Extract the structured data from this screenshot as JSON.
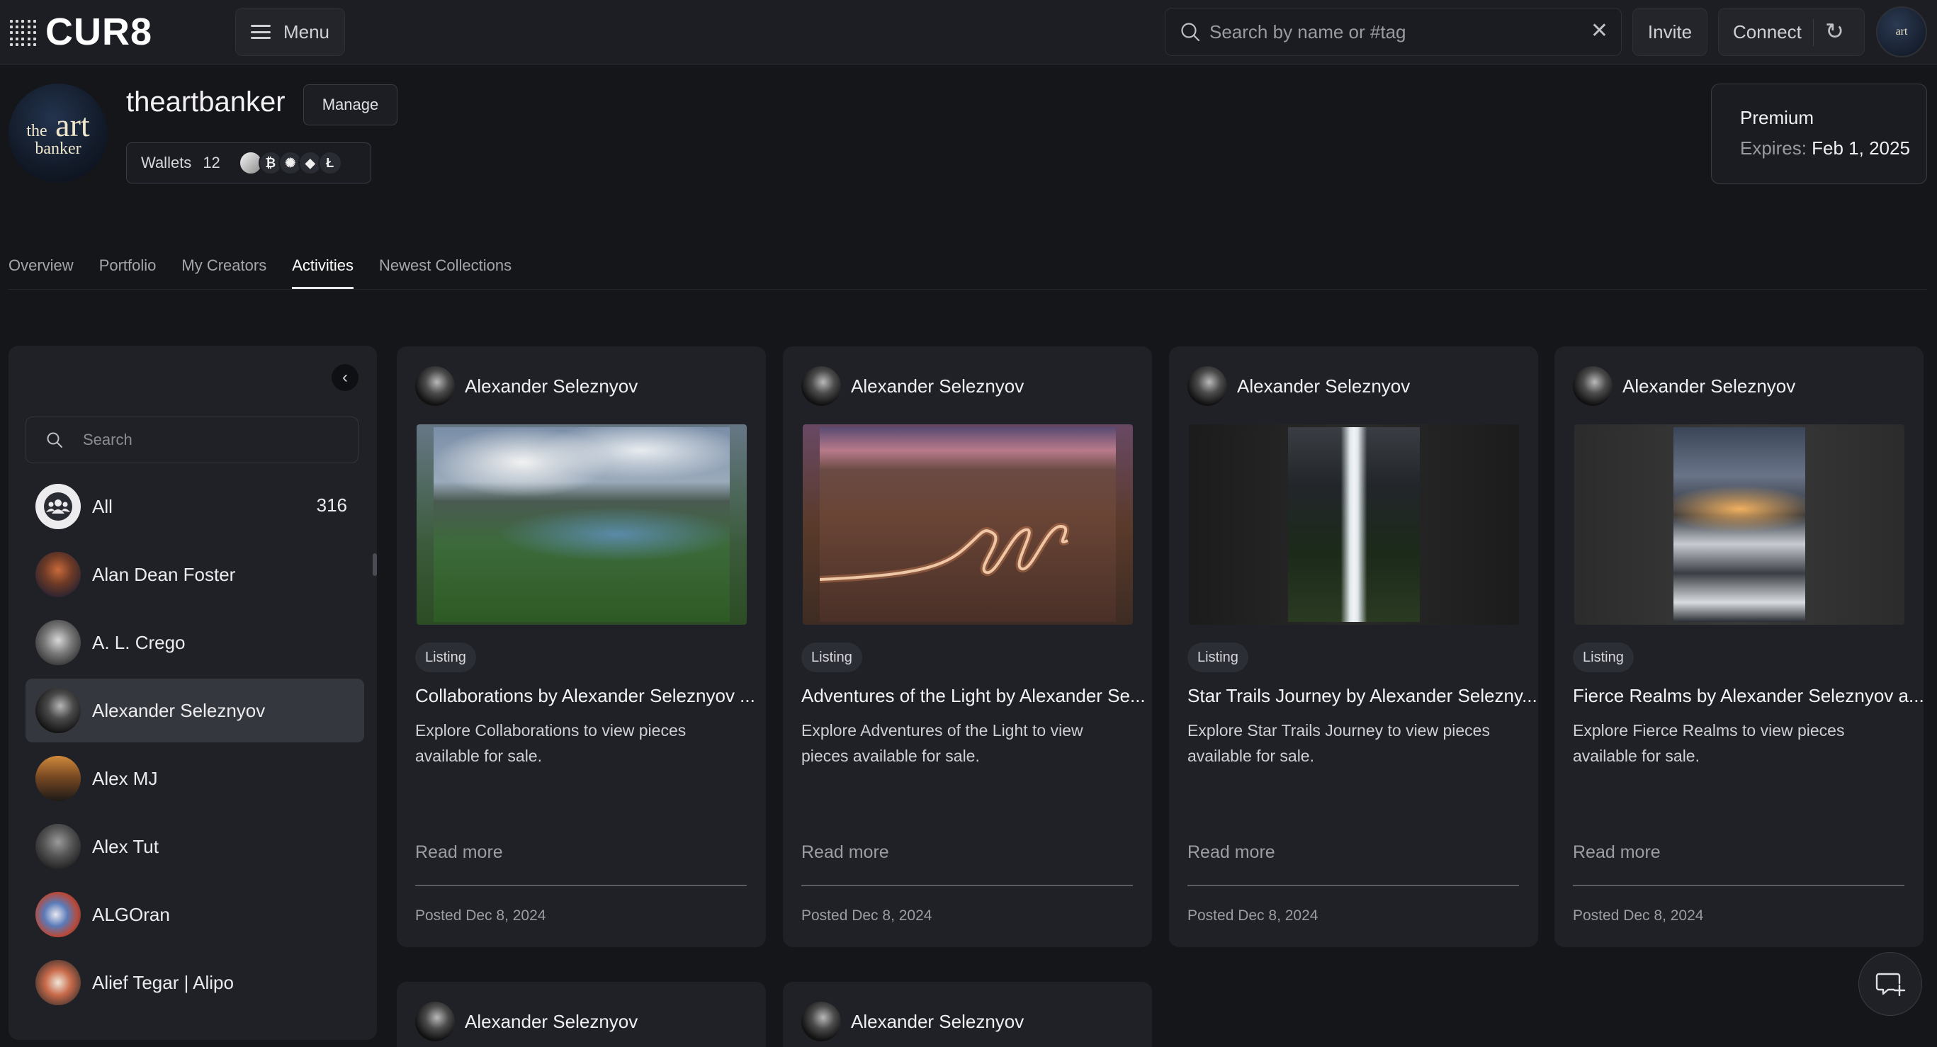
{
  "app": {
    "logo": "CUR8"
  },
  "topbar": {
    "menu_label": "Menu",
    "search_placeholder": "Search by name or #tag",
    "clear_icon": "close-icon",
    "invite_label": "Invite",
    "connect_label": "Connect",
    "refresh_icon": "refresh-icon"
  },
  "profile": {
    "name": "theartbanker",
    "manage_label": "Manage",
    "wallets_label": "Wallets",
    "wallets_count": "12",
    "wallet_icons": [
      "solana-icon",
      "bitcoin-icon",
      "cardano-icon",
      "ethereum-icon",
      "litecoin-icon"
    ],
    "avatar_text": {
      "the": "the",
      "art": "art",
      "banker": "banker"
    }
  },
  "premium": {
    "title": "Premium",
    "expires_label": "Expires:",
    "expires_value": "Feb 1, 2025"
  },
  "tabs": [
    {
      "label": "Overview",
      "active": false
    },
    {
      "label": "Portfolio",
      "active": false
    },
    {
      "label": "My Creators",
      "active": false
    },
    {
      "label": "Activities",
      "active": true
    },
    {
      "label": "Newest Collections",
      "active": false
    }
  ],
  "sidebar": {
    "search_placeholder": "Search",
    "items": [
      {
        "label": "All",
        "count": "316",
        "selected": false
      },
      {
        "label": "Alan Dean Foster",
        "selected": false
      },
      {
        "label": "A. L. Crego",
        "selected": false
      },
      {
        "label": "Alexander Seleznyov",
        "selected": true
      },
      {
        "label": "Alex MJ",
        "selected": false
      },
      {
        "label": "Alex Tut",
        "selected": false
      },
      {
        "label": "ALGOran",
        "selected": false
      },
      {
        "label": "Alief Tegar | Alipo",
        "selected": false
      }
    ]
  },
  "cards": [
    {
      "author": "Alexander Seleznyov",
      "badge": "Listing",
      "title": "Collaborations by Alexander Seleznyov ...",
      "desc": "Explore Collaborations to view pieces available for sale.",
      "read_more": "Read more",
      "posted": "Posted Dec 8, 2024"
    },
    {
      "author": "Alexander Seleznyov",
      "badge": "Listing",
      "title": "Adventures of the Light by Alexander Se...",
      "desc": "Explore Adventures of the Light to view pieces available for sale.",
      "read_more": "Read more",
      "posted": "Posted Dec 8, 2024"
    },
    {
      "author": "Alexander Seleznyov",
      "badge": "Listing",
      "title": "Star Trails Journey by Alexander Selezny...",
      "desc": "Explore Star Trails Journey to view pieces available for sale.",
      "read_more": "Read more",
      "posted": "Posted Dec 8, 2024"
    },
    {
      "author": "Alexander Seleznyov",
      "badge": "Listing",
      "title": "Fierce Realms by Alexander Seleznyov a...",
      "desc": "Explore Fierce Realms to view pieces available for sale.",
      "read_more": "Read more",
      "posted": "Posted Dec 8, 2024"
    },
    {
      "author": "Alexander Seleznyov"
    },
    {
      "author": "Alexander Seleznyov"
    }
  ]
}
